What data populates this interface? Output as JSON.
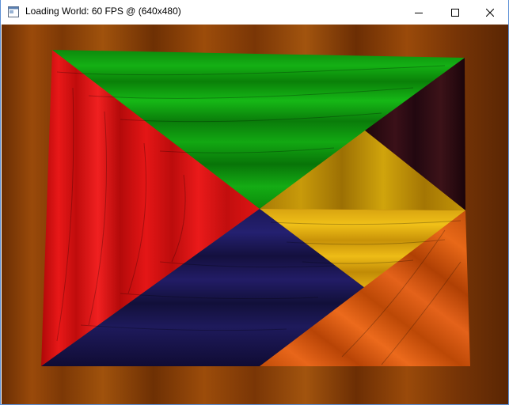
{
  "window": {
    "title": "Loading World: 60 FPS @ (640x480)",
    "icon": "app-window-icon",
    "buttons": {
      "minimize_icon": "minimize-icon",
      "maximize_icon": "maximize-icon",
      "close_icon": "close-icon"
    }
  },
  "scene": {
    "background_color": "#7a3a06",
    "panels": [
      {
        "name": "red-triangle",
        "color": "#d41010"
      },
      {
        "name": "green-triangle",
        "color": "#0a9a0a"
      },
      {
        "name": "dark-brown-triangle",
        "color": "#2a0a10"
      },
      {
        "name": "gold-triangle",
        "color": "#c89a08"
      },
      {
        "name": "navy-triangle",
        "color": "#1a1550"
      },
      {
        "name": "orange-triangle",
        "color": "#d85a10"
      }
    ]
  }
}
